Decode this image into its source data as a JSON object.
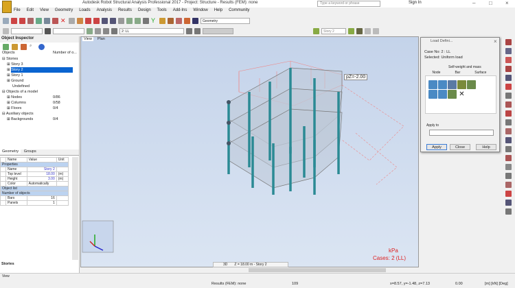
{
  "window": {
    "title": "Autodesk Robot Structural Analysis Professional 2017 - Project: Structure - Results (FEM): none",
    "search_placeholder": "Type a keyword or phrase",
    "sign_in": "Sign In"
  },
  "menu": [
    "File",
    "Edit",
    "View",
    "Geometry",
    "Loads",
    "Analysis",
    "Results",
    "Design",
    "Tools",
    "Add-Ins",
    "Window",
    "Help",
    "Community"
  ],
  "toolbar": {
    "layout_combo": "Geometry",
    "case_combo": "2: LL",
    "story_combo": "Story 2"
  },
  "object_inspector": {
    "title": "Object Inspector",
    "col_objects": "Objects",
    "col_number": "Number of o...",
    "tree": [
      {
        "label": "Stories",
        "count": ""
      },
      {
        "label": "Story 3",
        "count": ""
      },
      {
        "label": "Story 2",
        "count": "",
        "selected": true
      },
      {
        "label": "Story 1",
        "count": ""
      },
      {
        "label": "Ground",
        "count": ""
      },
      {
        "label": "Undefined",
        "count": ""
      },
      {
        "label": "Objects of a model",
        "count": ""
      },
      {
        "label": "Nodes",
        "count": "0/86"
      },
      {
        "label": "Columns",
        "count": "0/58"
      },
      {
        "label": "Floors",
        "count": "0/4"
      },
      {
        "label": "Auxiliary objects",
        "count": ""
      },
      {
        "label": "Backgrounds",
        "count": "0/4"
      }
    ]
  },
  "properties": {
    "tabs": [
      "Geometry",
      "Groups"
    ],
    "headers": [
      "Name",
      "Value",
      "Unit"
    ],
    "group_properties": "Properties",
    "rows": [
      [
        "Name",
        "Story 2",
        ""
      ],
      [
        "Top level",
        "18.00",
        "(m)"
      ],
      [
        "Height",
        "3.00",
        "(m)"
      ],
      [
        "Color",
        "Automatically",
        ""
      ]
    ],
    "group_object_list": "Object list",
    "group_number": "Number of objects",
    "count_rows": [
      [
        "Bars",
        "16"
      ],
      [
        "Panels",
        "1"
      ]
    ],
    "bottom_tab": "Stories"
  },
  "viewport": {
    "tabs": [
      "View",
      "Plan"
    ],
    "load_label": "pZ=-2.00",
    "units": "kPa",
    "cases": "Cases: 2 (LL)",
    "story_nav": "Z = 18.00 m - Story 2",
    "nav_code": "3D"
  },
  "dialog": {
    "title": "Load Defini...",
    "case": "Case No: 2 : LL",
    "selected": "Selected:   Uniform load",
    "group": "Self-weight and mass",
    "tabs": [
      "Node",
      "Bar",
      "Surface"
    ],
    "apply_to": "Apply to",
    "apply_to_value": "",
    "buttons": [
      "Apply",
      "Close",
      "Help"
    ]
  },
  "status": {
    "view": "View",
    "results": "Results (FEM): none",
    "count": "109",
    "coords": "x=8.57, y=-1.48, z=7.13",
    "angle": "0.00",
    "units": "[m] [kN] [Deg]"
  }
}
